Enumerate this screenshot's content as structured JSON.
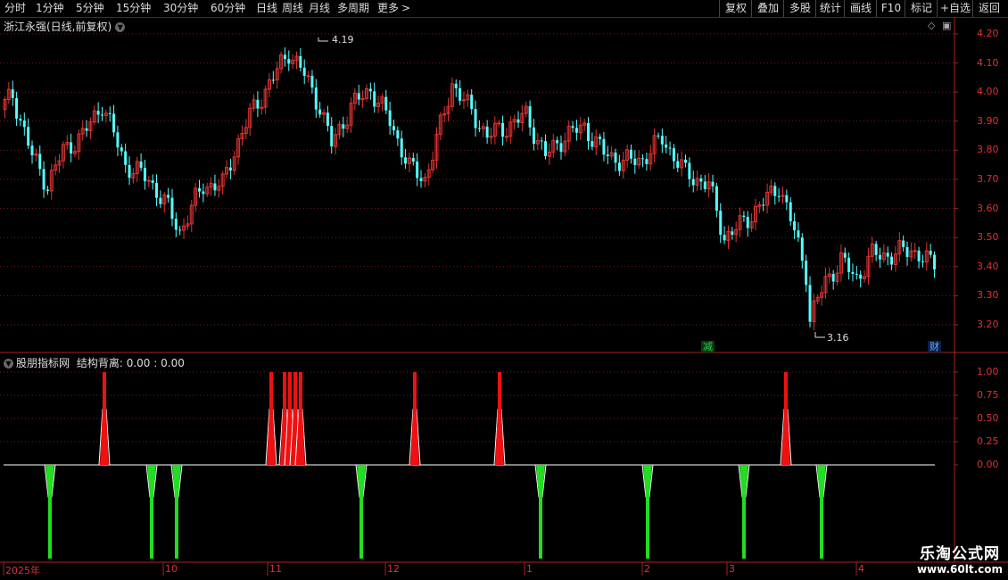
{
  "toolbar": {
    "periods": [
      "分时",
      "1分钟",
      "5分钟",
      "15分钟",
      "30分钟",
      "60分钟",
      "日线",
      "周线",
      "月线",
      "多周期",
      "更多"
    ],
    "more_arrow": ">",
    "right_buttons": [
      "复权",
      "叠加",
      "多股",
      "统计",
      "画线",
      "F10",
      "标记",
      "+自选",
      "返回"
    ]
  },
  "main_chart": {
    "title": "浙江永强(日线,前复权)",
    "high_label": "4.19",
    "low_label": "3.16",
    "y_ticks": [
      "4.20",
      "4.10",
      "4.00",
      "3.90",
      "3.80",
      "3.70",
      "3.60",
      "3.50",
      "3.40",
      "3.30",
      "3.20"
    ],
    "y_values": [
      4.2,
      4.1,
      4.0,
      3.9,
      3.8,
      3.7,
      3.6,
      3.5,
      3.4,
      3.3,
      3.2
    ],
    "event_badges": [
      {
        "text": "减",
        "color": "#35c35a"
      },
      {
        "text": "财",
        "color": "#3a7bd5"
      }
    ],
    "colors": {
      "up": "#e03434",
      "down": "#54ffff",
      "grid": "#7a1c1c",
      "axis": "#aa2222"
    }
  },
  "indicator": {
    "name": "股朋指标网",
    "label": "结构背离:",
    "value1": "0.00",
    "sep": ":",
    "value2": "0.00",
    "y_ticks": [
      "1.00",
      "0.75",
      "0.50",
      "0.25",
      "0.00"
    ],
    "colors": {
      "positive": "#ee1111",
      "negative": "#22dd22",
      "zero": "#ffffff"
    }
  },
  "time_axis": {
    "labels": [
      "2025年",
      "10",
      "11",
      "12",
      "1",
      "2",
      "3",
      "4"
    ]
  },
  "watermark": {
    "line1": "乐淘公式网",
    "line2": "www.60lt.com"
  }
}
